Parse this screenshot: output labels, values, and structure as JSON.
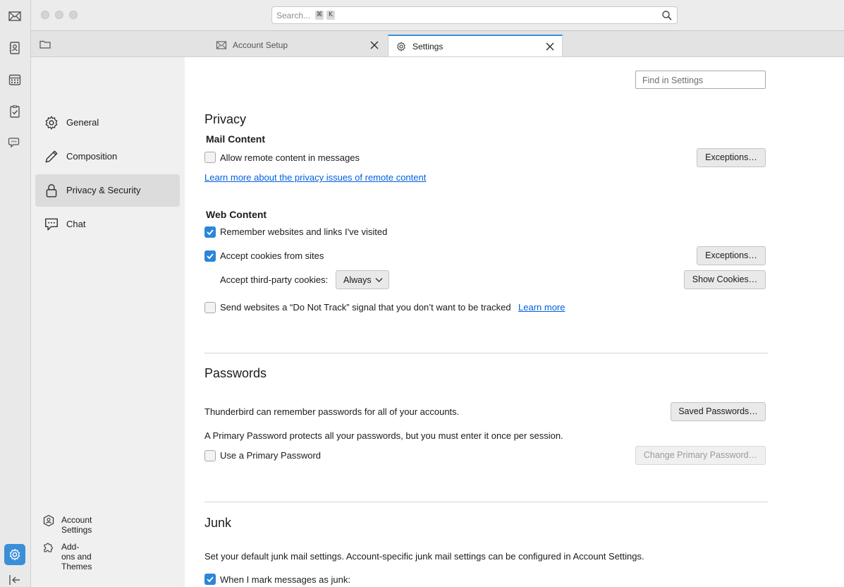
{
  "search": {
    "placeholder": "Search...",
    "shortcut_cmd": "⌘",
    "shortcut_key": "K"
  },
  "tabs": [
    {
      "label": "Account Setup",
      "icon": "envelope-icon"
    },
    {
      "label": "Settings",
      "icon": "gear-icon"
    }
  ],
  "sidebar": {
    "categories": [
      {
        "label": "General",
        "icon": "gear-icon"
      },
      {
        "label": "Composition",
        "icon": "pencil-icon"
      },
      {
        "label": "Privacy & Security",
        "icon": "lock-icon",
        "selected": true
      },
      {
        "label": "Chat",
        "icon": "chat-icon"
      }
    ],
    "footer": [
      {
        "label": "Account Settings",
        "icon": "account-settings-icon"
      },
      {
        "label": "Add-ons and Themes",
        "icon": "puzzle-icon"
      }
    ]
  },
  "find_in_settings": {
    "placeholder": "Find in Settings"
  },
  "privacy": {
    "title": "Privacy",
    "mail_content": {
      "heading": "Mail Content",
      "allow_remote": {
        "label": "Allow remote content in messages",
        "checked": false
      },
      "exceptions_label": "Exceptions…",
      "learn_more": "Learn more about the privacy issues of remote content"
    },
    "web_content": {
      "heading": "Web Content",
      "remember": {
        "label": "Remember websites and links I've visited",
        "checked": true
      },
      "cookies": {
        "label": "Accept cookies from sites",
        "checked": true
      },
      "exceptions_label": "Exceptions…",
      "third_party_label": "Accept third-party cookies:",
      "third_party_value": "Always",
      "show_cookies_label": "Show Cookies…",
      "dnt": {
        "label": "Send websites a “Do Not Track” signal that you don’t want to be tracked",
        "checked": false
      },
      "dnt_learn_more": "Learn more"
    }
  },
  "passwords": {
    "title": "Passwords",
    "remember_text": "Thunderbird can remember passwords for all of your accounts.",
    "saved_passwords_label": "Saved Passwords…",
    "primary_text": "A Primary Password protects all your passwords, but you must enter it once per session.",
    "use_primary": {
      "label": "Use a Primary Password",
      "checked": false
    },
    "change_primary_label": "Change Primary Password…"
  },
  "junk": {
    "title": "Junk",
    "description": "Set your default junk mail settings. Account-specific junk mail settings can be configured in Account Settings.",
    "when_mark": {
      "label": "When I mark messages as junk:",
      "checked": true
    }
  },
  "colors": {
    "accent": "#2c86d8",
    "link": "#0060df"
  }
}
